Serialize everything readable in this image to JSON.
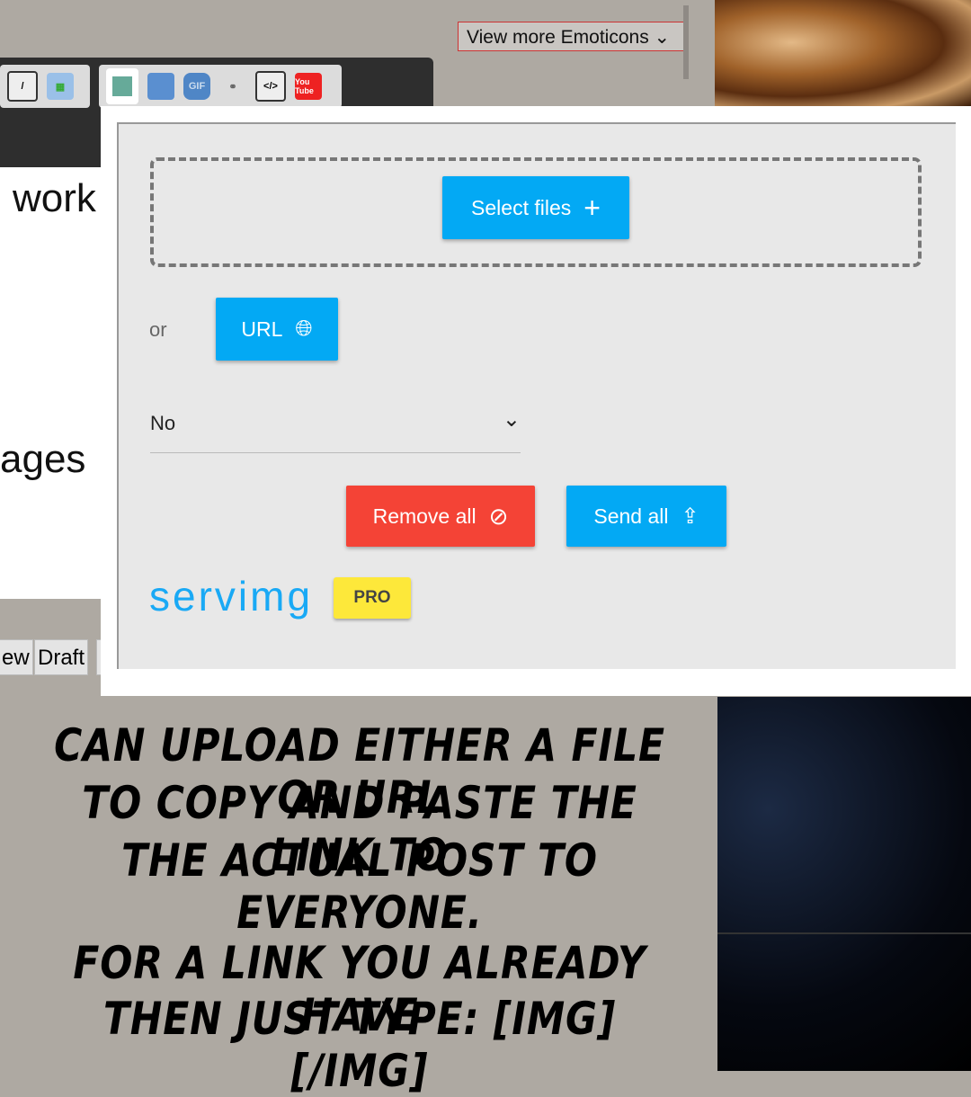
{
  "emoticons": {
    "label": "View more Emoticons"
  },
  "toolbar": {
    "icons": [
      "strikethrough-icon",
      "insert-table-icon",
      "host-image-icon",
      "insert-image-icon",
      "gif-icon",
      "insert-link-icon",
      "embed-code-icon",
      "youtube-icon"
    ],
    "gif_label": "GIF",
    "youtube_label": "You Tube"
  },
  "editor": {
    "text1": "work",
    "text2": "ages"
  },
  "bottom_buttons": {
    "preview": "ew",
    "draft": "Draft"
  },
  "upload": {
    "select_files": "Select files",
    "or": "or",
    "url": "URL",
    "select_value": "No",
    "remove_all": "Remove all",
    "send_all": "Send all",
    "logo": "servimg",
    "pro": "PRO",
    "colors": {
      "blue": "#03a9f4",
      "red": "#f44336",
      "yellow": "#fde83a"
    }
  },
  "annotation": {
    "line1": "Can upload either a file or URL",
    "line2": "to copy and paste the link to",
    "line3": "the actual post to everyone.",
    "line4": "For a link you already have",
    "line5": "then just type: [IMG] [/IMG]"
  }
}
